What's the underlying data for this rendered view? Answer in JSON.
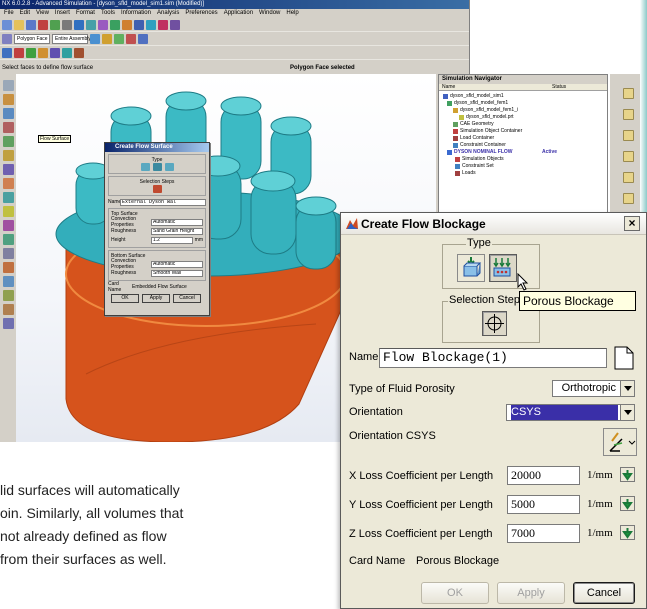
{
  "app": {
    "title": "NX 6.0.2.8 - Advanced Simulation - [dyson_sfld_model_sim1.sim (Modified)]",
    "menu": [
      "File",
      "Edit",
      "View",
      "Insert",
      "Format",
      "Tools",
      "Information",
      "Analysis",
      "Preferences",
      "Application",
      "Window",
      "Help"
    ],
    "toolbar_fields": [
      "Polygon Face",
      "Entire Assembly"
    ],
    "status_left": "Select faces to define flow surface",
    "status_mid": "Polygon Face selected",
    "flow_surface_tooltip": "Flow Surface"
  },
  "sim_navigator": {
    "title": "Simulation Navigator",
    "columns": [
      "Name",
      "Status"
    ],
    "items": [
      {
        "label": "dyson_sfld_model_sim1",
        "status": ""
      },
      {
        "label": "dyson_sfld_model_fem1",
        "status": ""
      },
      {
        "label": "dyson_sfld_model_fem1_i",
        "status": ""
      },
      {
        "label": "dyson_sfld_model.prt",
        "status": ""
      },
      {
        "label": "CAE Geometry",
        "status": ""
      },
      {
        "label": "Simulation Object Container",
        "status": ""
      },
      {
        "label": "Load Container",
        "status": ""
      },
      {
        "label": "Constraint Container",
        "status": ""
      },
      {
        "label": "DYSON NOMINAL FLOW",
        "status": "Active"
      },
      {
        "label": "Simulation Objects",
        "status": ""
      },
      {
        "label": "Constraint Set",
        "status": ""
      },
      {
        "label": "Loads",
        "status": ""
      }
    ]
  },
  "flow_surface_dialog": {
    "title": "Create Flow Surface",
    "type_label": "Type",
    "selection_steps_label": "Selection Steps",
    "name_label": "Name",
    "name_value": "External Dyson Wal",
    "top_surface_label": "Top Surface",
    "convection_label": "Convection Properties",
    "convection_value": "Automatic",
    "roughness_label": "Roughness",
    "roughness_top_value": "Sand Grain Height",
    "height_label": "Height",
    "height_value": "1.2",
    "height_unit": "mm",
    "bottom_surface_label": "Bottom Surface",
    "roughness_bottom_value": "Smooth Wall",
    "card_name_label": "Card Name",
    "card_name_value": "Embedded Flow Surface",
    "ok": "OK",
    "apply": "Apply",
    "cancel": "Cancel"
  },
  "flow_blockage_dialog": {
    "title": "Create Flow Blockage",
    "close": "×",
    "type_label": "Type",
    "selection_steps_label": "Selection Steps",
    "tooltip": "Porous Blockage",
    "name_label": "Name",
    "name_value": "Flow Blockage(1)",
    "fluid_porosity_label": "Type of Fluid Porosity",
    "fluid_porosity_value": "Orthotropic",
    "orientation_label": "Orientation",
    "orientation_value": "CSYS",
    "orientation_csys_label": "Orientation CSYS",
    "x_loss_label": "X Loss Coefficient per Length",
    "x_loss_value": "20000",
    "y_loss_label": "Y Loss Coefficient per Length",
    "y_loss_value": "5000",
    "z_loss_label": "Z Loss Coefficient per Length",
    "z_loss_value": "7000",
    "unit": "1/mm",
    "card_name_label": "Card Name",
    "card_name_value": "Porous Blockage",
    "ok": "OK",
    "apply": "Apply",
    "cancel": "Cancel"
  },
  "body_text": [
    "lid surfaces will automatically",
    "oin. Similarly, all volumes that",
    "not already defined as flow",
    "from their surfaces as well."
  ],
  "colors": {
    "teal_model": "#3fb9c1",
    "orange_model": "#d9551e",
    "selection_highlight": "#3a2fa8",
    "title_bar": "#0a246a"
  }
}
